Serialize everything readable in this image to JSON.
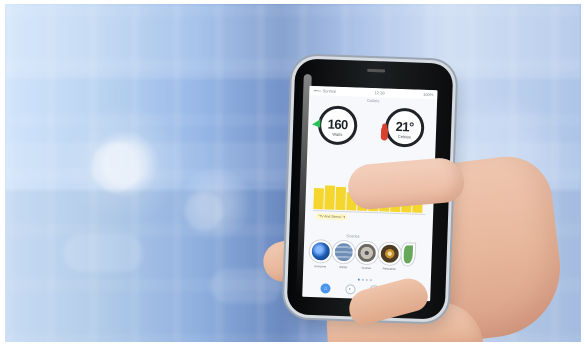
{
  "status_bar": {
    "carrier": "••••○ Sunrise",
    "time": "12:38",
    "battery": "100%"
  },
  "screen": {
    "section_title": "Outlets",
    "power_gauge": {
      "value": "160",
      "unit": "Watts"
    },
    "temperature_gauge": {
      "value": "21°",
      "unit": "Celsius"
    },
    "chart_caption": "\"TV And Stereo\" ▾",
    "modes_title": "Scenes",
    "mode_labels": [
      "Everyone",
      "Winter",
      "Sunrise",
      "Relaxation"
    ]
  },
  "colors": {
    "accent_yellow": "#f4d62e",
    "accent_blue": "#4a8de7",
    "power_green": "#2ac15a",
    "temperature_red": "#d7412d"
  }
}
